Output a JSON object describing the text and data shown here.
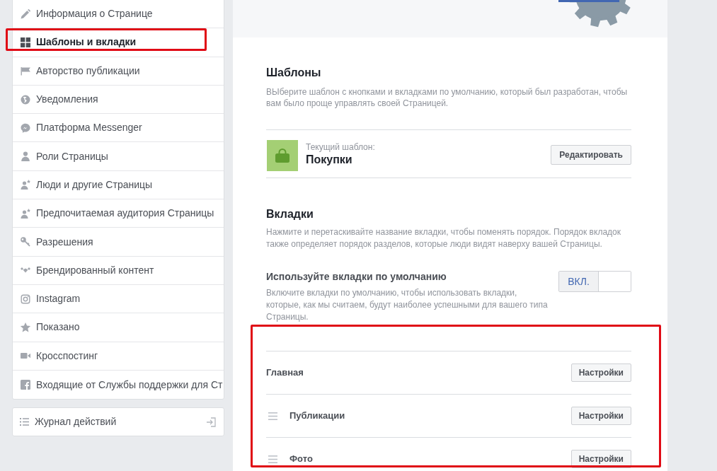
{
  "sidebar": {
    "items": [
      {
        "label": "Информация о Странице",
        "selected": false,
        "highlighted": false
      },
      {
        "label": "Шаблоны и вкладки",
        "selected": true,
        "highlighted": true
      },
      {
        "label": "Авторство публикации",
        "selected": false,
        "highlighted": false
      },
      {
        "label": "Уведомления",
        "selected": false,
        "highlighted": false
      },
      {
        "label": "Платформа Messenger",
        "selected": false,
        "highlighted": false
      },
      {
        "label": "Роли Страницы",
        "selected": false,
        "highlighted": false
      },
      {
        "label": "Люди и другие Страницы",
        "selected": false,
        "highlighted": false
      },
      {
        "label": "Предпочитаемая аудитория Страницы",
        "selected": false,
        "highlighted": false
      },
      {
        "label": "Разрешения",
        "selected": false,
        "highlighted": false
      },
      {
        "label": "Брендированный контент",
        "selected": false,
        "highlighted": false
      },
      {
        "label": "Instagram",
        "selected": false,
        "highlighted": false
      },
      {
        "label": "Показано",
        "selected": false,
        "highlighted": false
      },
      {
        "label": "Кросспостинг",
        "selected": false,
        "highlighted": false
      },
      {
        "label": "Входящие от Службы поддержки для Ст",
        "selected": false,
        "highlighted": false
      }
    ]
  },
  "activity_log": {
    "label": "Журнал действий"
  },
  "templates": {
    "title": "Шаблоны",
    "description": "ВЫберите шаблон с кнопками и вкладками по умолчанию, который был разработан, чтобы вам было проще управлять своей Страницей.",
    "current_template": {
      "caption": "Текущий шаблон:",
      "name": "Покупки"
    },
    "edit_button": "Редактировать"
  },
  "tabs_section": {
    "title": "Вкладки",
    "description": "Нажмите и перетаскивайте название вкладки, чтобы поменять порядок. Порядок вкладок также определяет порядок разделов, которые люди видят наверху вашей Страницы.",
    "default_tabs": {
      "title": "Используйте вкладки по умолчанию",
      "description": "Включите вкладки по умолчанию, чтобы использовать вкладки, которые, как мы считаем, будут наиболее успешными для вашего типа Страницы.",
      "toggle": {
        "label": "ВКЛ.",
        "on": true
      }
    },
    "highlighted": true,
    "tabs": [
      {
        "name": "Главная",
        "draggable": false,
        "button": "Настройки"
      },
      {
        "name": "Публикации",
        "draggable": true,
        "button": "Настройки"
      },
      {
        "name": "Фото",
        "draggable": true,
        "button": "Настройки"
      }
    ]
  }
}
